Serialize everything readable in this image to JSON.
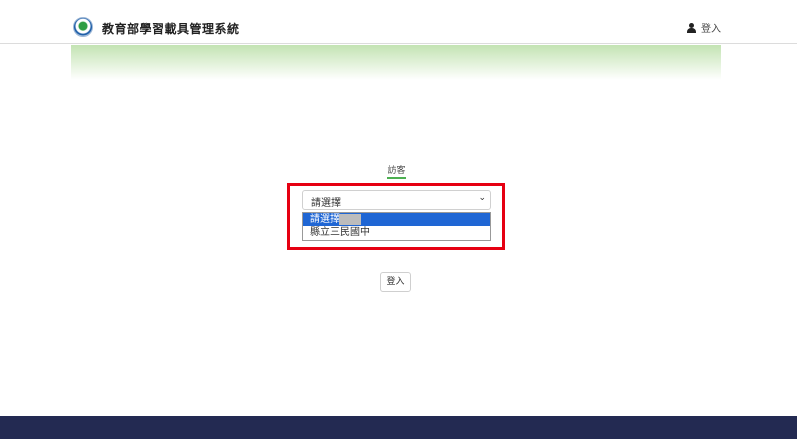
{
  "header": {
    "site_title": "教育部學習載具管理系統",
    "login_label": "登入"
  },
  "main": {
    "tab_label": "訪客",
    "school_select": {
      "value": "請選擇",
      "options": [
        "請選擇",
        "縣立三民國中"
      ],
      "highlighted_option": "請選擇"
    },
    "login_button_label": "登入"
  },
  "colors": {
    "accent_green": "#4caf50",
    "highlight_red": "#e60012",
    "option_selected_blue": "#1f66d4",
    "footer_navy": "#232a52"
  }
}
